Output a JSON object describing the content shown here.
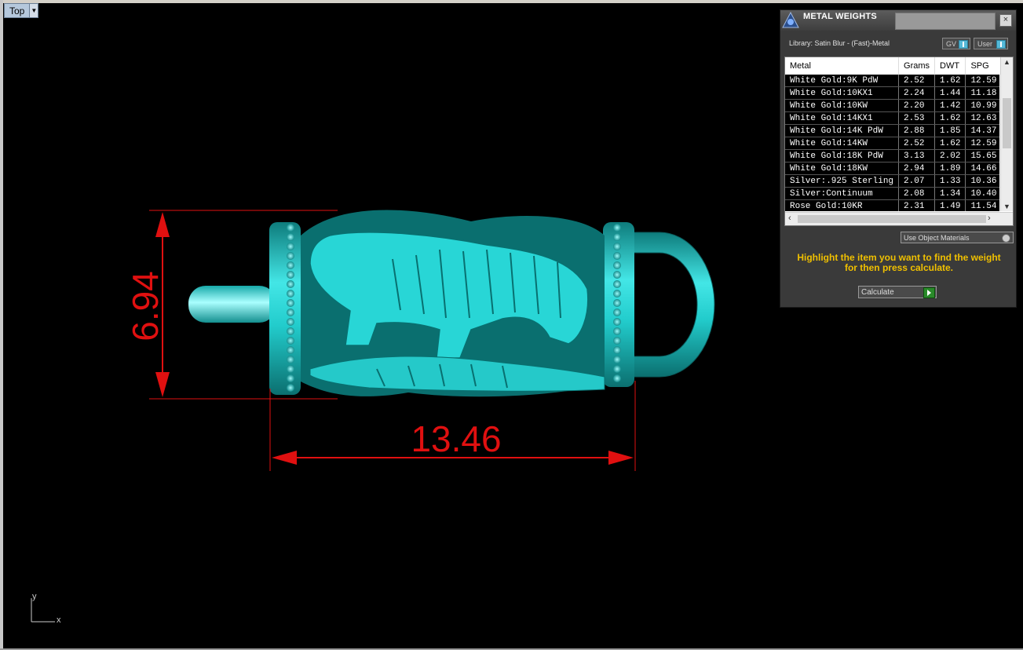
{
  "viewport": {
    "name": "Top"
  },
  "dimensions": {
    "height": "6.94",
    "width": "13.46"
  },
  "axis": {
    "y": "y",
    "x": "x"
  },
  "panel": {
    "title": "METAL WEIGHTS",
    "close": "×",
    "library": "Library: Satin Blur - (Fast)-Metal",
    "toggle_gv": "GV",
    "toggle_user": "User",
    "columns": [
      "Metal",
      "Grams",
      "DWT",
      "SPG"
    ],
    "rows": [
      [
        "White Gold:9K PdW",
        "2.52",
        "1.62",
        "12.59"
      ],
      [
        "White Gold:10KX1",
        "2.24",
        "1.44",
        "11.18"
      ],
      [
        "White Gold:10KW",
        "2.20",
        "1.42",
        "10.99"
      ],
      [
        "White Gold:14KX1",
        "2.53",
        "1.62",
        "12.63"
      ],
      [
        "White Gold:14K PdW",
        "2.88",
        "1.85",
        "14.37"
      ],
      [
        "White Gold:14KW",
        "2.52",
        "1.62",
        "12.59"
      ],
      [
        "White Gold:18K PdW",
        "3.13",
        "2.02",
        "15.65"
      ],
      [
        "White Gold:18KW",
        "2.94",
        "1.89",
        "14.66"
      ],
      [
        "Silver:.925 Sterling",
        "2.07",
        "1.33",
        "10.36"
      ],
      [
        "Silver:Continuum",
        "2.08",
        "1.34",
        "10.40"
      ],
      [
        "Rose Gold:10KR",
        "2.31",
        "1.49",
        "11.54"
      ]
    ],
    "use_object_materials": "Use Object Materials",
    "hint": "Highlight the item you want to find the weight for then press calculate.",
    "calculate": "Calculate"
  },
  "colors": {
    "model": "#20c8c8",
    "dimension": "#e01010",
    "hint": "#f0c000"
  }
}
